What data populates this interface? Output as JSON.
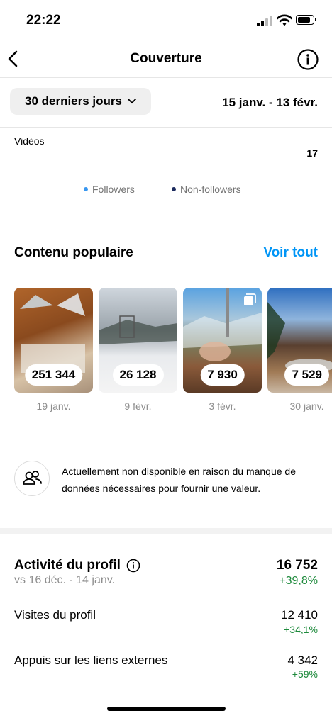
{
  "status_bar": {
    "time": "22:22"
  },
  "nav": {
    "title": "Couverture"
  },
  "filters": {
    "period": "30 derniers jours",
    "date_range": "15 janv. - 13 févr."
  },
  "videos": {
    "label": "Vidéos",
    "count": "17",
    "legend": [
      {
        "label": "Followers",
        "color": "#3897f0"
      },
      {
        "label": "Non-followers",
        "color": "#1c2b5e"
      }
    ]
  },
  "popular": {
    "title": "Contenu populaire",
    "see_all": "Voir tout",
    "items": [
      {
        "count": "251 344",
        "date": "19 janv."
      },
      {
        "count": "26 128",
        "date": "9 févr."
      },
      {
        "count": "7 930",
        "date": "3 févr."
      },
      {
        "count": "7 529",
        "date": "30 janv."
      }
    ]
  },
  "notice": {
    "text": "Actuellement non disponible en raison du manque de données nécessaires pour fournir une valeur."
  },
  "profile_activity": {
    "title": "Activité du profil",
    "compare": "vs 16 déc. - 14 janv.",
    "total": "16 752",
    "change": "+39,8%",
    "rows": [
      {
        "label": "Visites du profil",
        "value": "12 410",
        "change": "+34,1%"
      },
      {
        "label": "Appuis sur les liens externes",
        "value": "4 342",
        "change": "+59%"
      }
    ]
  }
}
